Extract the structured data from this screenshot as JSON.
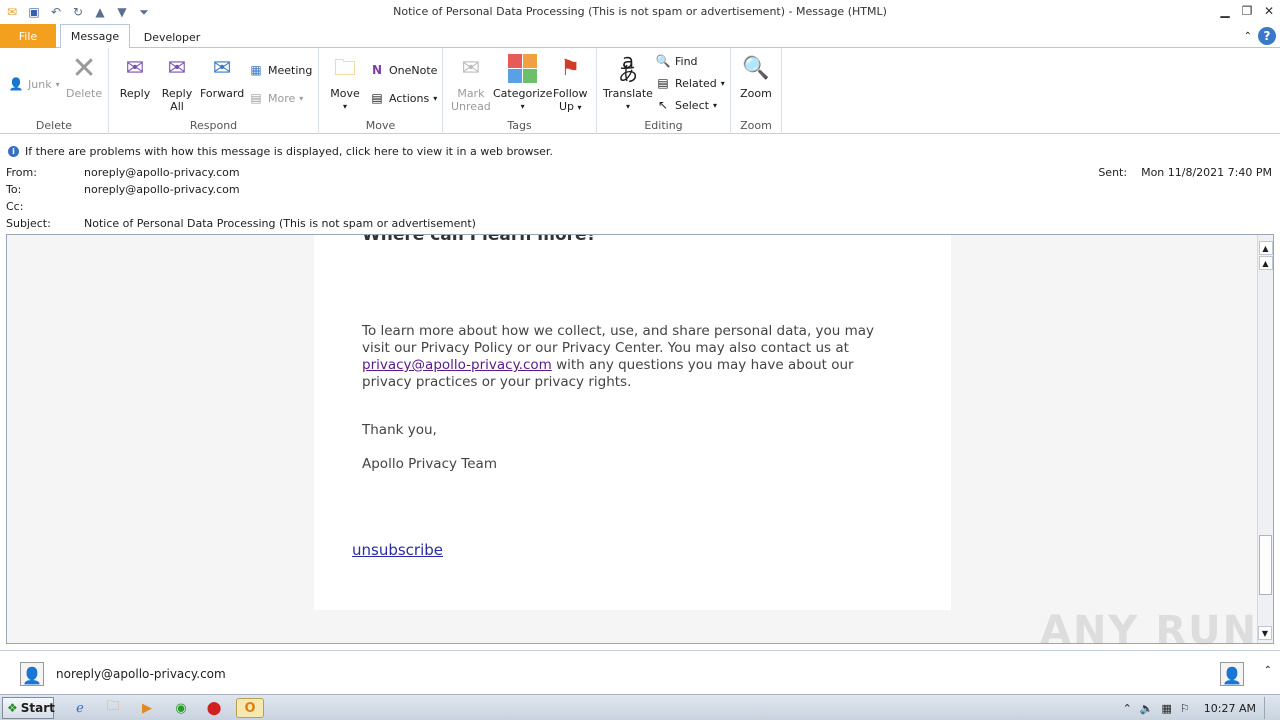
{
  "window": {
    "title": "Notice of Personal Data Processing (This is not spam or advertisement)  -  Message (HTML)"
  },
  "tabs": {
    "file": "File",
    "message": "Message",
    "developer": "Developer"
  },
  "ribbon": {
    "delete_group": {
      "label": "Delete",
      "junk": "Junk",
      "delete": "Delete"
    },
    "respond_group": {
      "label": "Respond",
      "reply": "Reply",
      "reply_all_1": "Reply",
      "reply_all_2": "All",
      "forward": "Forward",
      "meeting": "Meeting",
      "more": "More"
    },
    "move_group": {
      "label": "Move",
      "move": "Move",
      "onenote": "OneNote",
      "actions": "Actions"
    },
    "tags_group": {
      "label": "Tags",
      "mark_1": "Mark",
      "mark_2": "Unread",
      "categorize": "Categorize",
      "follow_1": "Follow",
      "follow_2": "Up"
    },
    "editing_group": {
      "label": "Editing",
      "translate": "Translate",
      "find": "Find",
      "related": "Related",
      "select": "Select"
    },
    "zoom_group": {
      "label": "Zoom",
      "zoom": "Zoom"
    }
  },
  "header": {
    "info": "If there are problems with how this message is displayed, click here to view it in a web browser.",
    "from_label": "From:",
    "from": "noreply@apollo-privacy.com",
    "to_label": "To:",
    "to": "noreply@apollo-privacy.com",
    "cc_label": "Cc:",
    "cc": "",
    "subject_label": "Subject:",
    "subject": "Notice of Personal Data Processing (This is not spam or advertisement)",
    "sent_label": "Sent:",
    "sent": "Mon 11/8/2021 7:40 PM"
  },
  "body": {
    "heading": "Where can I learn more?",
    "para_1": "To learn more about how we collect, use, and share personal data, you may visit our Privacy Policy or our Privacy Center. You may also contact us at ",
    "email_link": "privacy@apollo-privacy.com",
    "para_2": " with any questions you may have about our privacy practices or your privacy rights.",
    "thanks": "Thank you,",
    "team": "Apollo Privacy Team",
    "unsubscribe": "unsubscribe"
  },
  "people_pane": {
    "contact": "noreply@apollo-privacy.com"
  },
  "taskbar": {
    "start": "Start",
    "clock": "10:27 AM"
  },
  "watermark": "ANY RUN"
}
